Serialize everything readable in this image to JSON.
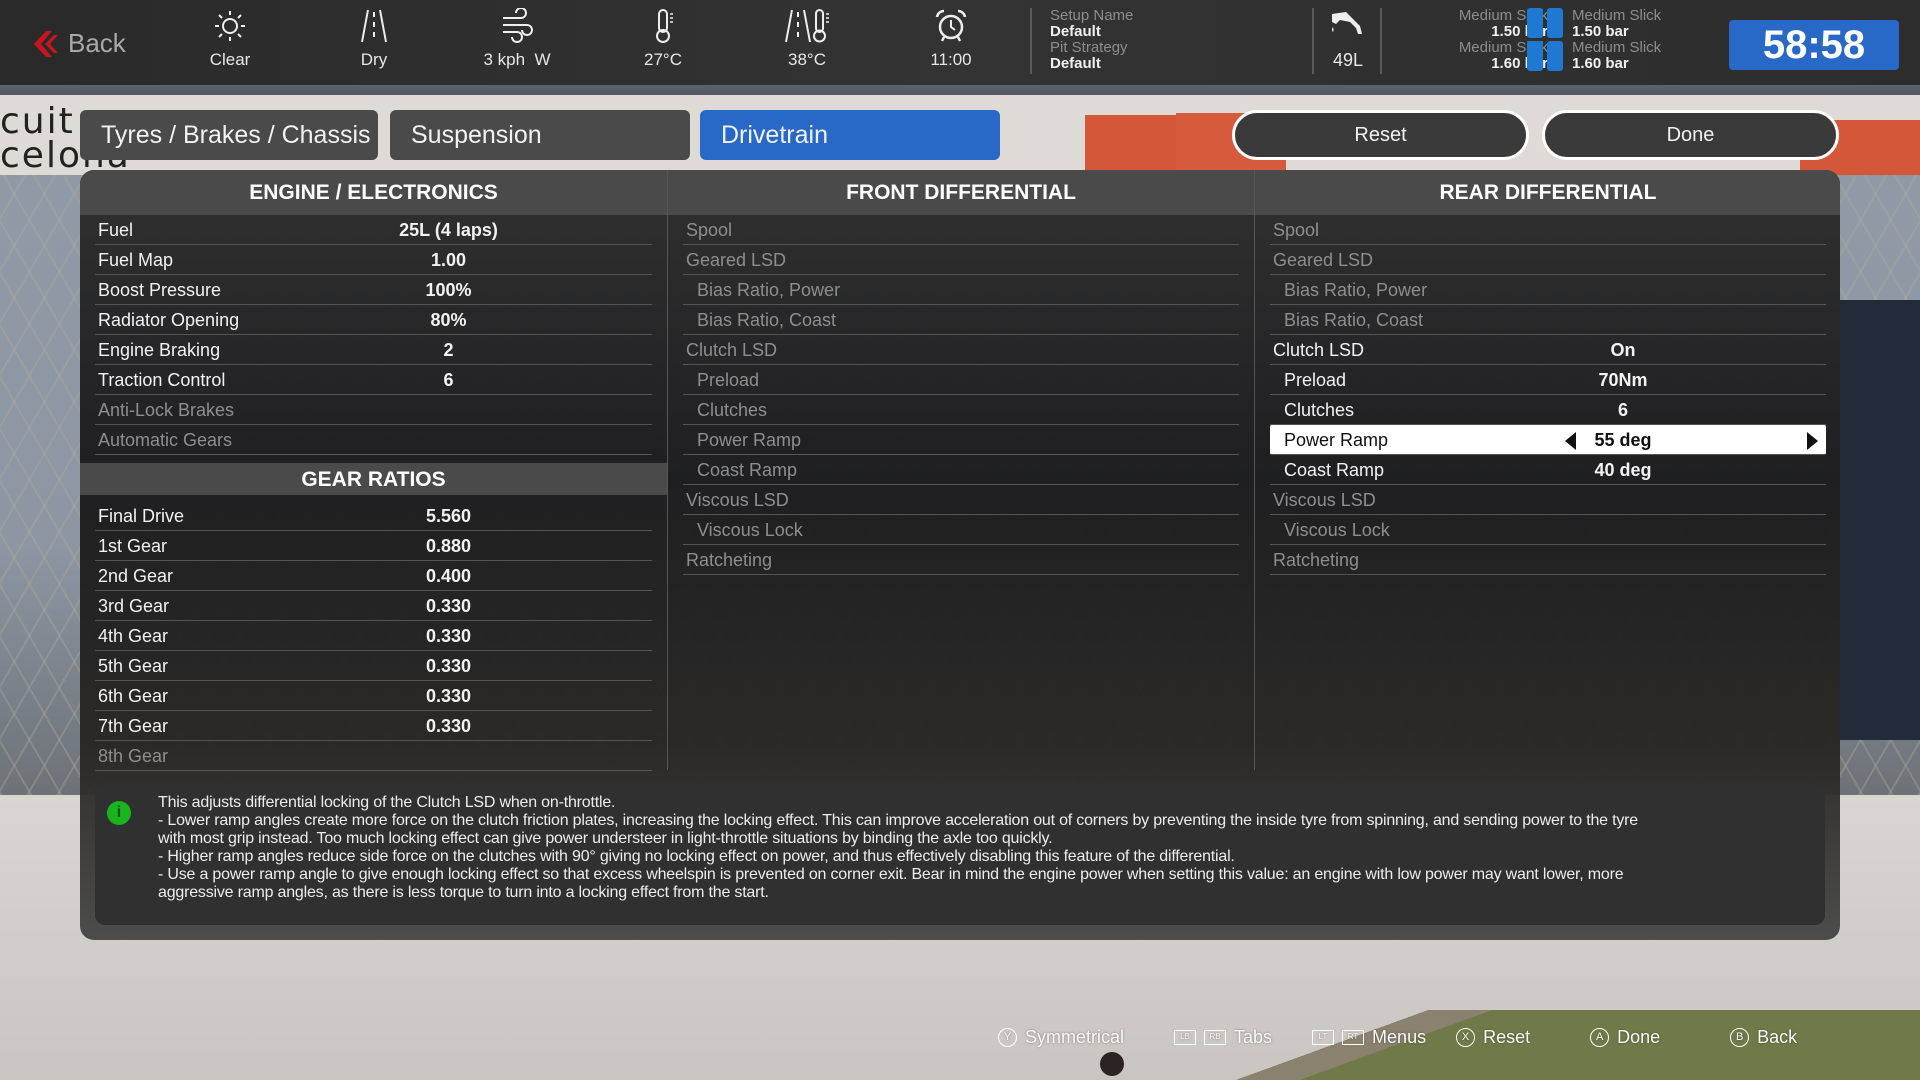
{
  "topbar": {
    "back_label": "Back",
    "weather": {
      "icon": "sun-icon",
      "label": "Clear"
    },
    "track_condition": {
      "icon": "road-icon",
      "label": "Dry"
    },
    "wind": {
      "icon": "wind-icon",
      "label": "3 kph  W"
    },
    "air_temp": {
      "icon": "thermometer-icon",
      "label": "27°C"
    },
    "track_temp": {
      "icon": "road-thermometer-icon",
      "label": "38°C"
    },
    "time_of_day": {
      "icon": "alarm-clock-icon",
      "label": "11:00"
    },
    "setup_name_key": "Setup Name",
    "setup_name_value": "Default",
    "pit_strategy_key": "Pit Strategy",
    "pit_strategy_value": "Default",
    "fuel": {
      "icon": "fuel-nozzle-icon",
      "label": "49L"
    },
    "tyres": {
      "front_left": {
        "compound": "Medium Slick",
        "pressure": "1.50 bar"
      },
      "front_right": {
        "compound": "Medium Slick",
        "pressure": "1.50 bar"
      },
      "rear_left": {
        "compound": "Medium Slick",
        "pressure": "1.60 bar"
      },
      "rear_right": {
        "compound": "Medium Slick",
        "pressure": "1.60 bar"
      },
      "color": "#1f78d1"
    },
    "timer": "58:58"
  },
  "tabs": [
    {
      "label": "Tyres / Brakes / Chassis",
      "active": false
    },
    {
      "label": "Suspension",
      "active": false
    },
    {
      "label": "Drivetrain",
      "active": true
    }
  ],
  "actions": {
    "reset_label": "Reset",
    "done_label": "Done"
  },
  "engine": {
    "title": "ENGINE / ELECTRONICS",
    "rows": [
      {
        "label": "Fuel",
        "value": "25L  (4 laps)"
      },
      {
        "label": "Fuel Map",
        "value": "1.00"
      },
      {
        "label": "Boost Pressure",
        "value": "100%"
      },
      {
        "label": "Radiator Opening",
        "value": "80%"
      },
      {
        "label": "Engine Braking",
        "value": "2"
      },
      {
        "label": "Traction Control",
        "value": "6"
      },
      {
        "label": "Anti-Lock Brakes",
        "value": ""
      },
      {
        "label": "Automatic Gears",
        "value": ""
      }
    ]
  },
  "gear_ratios": {
    "title": "GEAR RATIOS",
    "rows": [
      {
        "label": "Final Drive",
        "value": "5.560"
      },
      {
        "label": "1st Gear",
        "value": "0.880"
      },
      {
        "label": "2nd Gear",
        "value": "0.400"
      },
      {
        "label": "3rd Gear",
        "value": "0.330"
      },
      {
        "label": "4th Gear",
        "value": "0.330"
      },
      {
        "label": "5th Gear",
        "value": "0.330"
      },
      {
        "label": "6th Gear",
        "value": "0.330"
      },
      {
        "label": "7th Gear",
        "value": "0.330"
      },
      {
        "label": "8th Gear",
        "value": ""
      }
    ]
  },
  "front_diff": {
    "title": "FRONT DIFFERENTIAL",
    "rows": [
      {
        "label": "Spool",
        "value": ""
      },
      {
        "label": "Geared LSD",
        "value": ""
      },
      {
        "label": "Bias Ratio, Power",
        "value": ""
      },
      {
        "label": "Bias Ratio, Coast",
        "value": ""
      },
      {
        "label": "Clutch LSD",
        "value": ""
      },
      {
        "label": "Preload",
        "value": ""
      },
      {
        "label": "Clutches",
        "value": ""
      },
      {
        "label": "Power Ramp",
        "value": ""
      },
      {
        "label": "Coast Ramp",
        "value": ""
      },
      {
        "label": "Viscous LSD",
        "value": ""
      },
      {
        "label": "Viscous Lock",
        "value": ""
      },
      {
        "label": "Ratcheting",
        "value": ""
      }
    ]
  },
  "rear_diff": {
    "title": "REAR DIFFERENTIAL",
    "rows": [
      {
        "label": "Spool",
        "value": ""
      },
      {
        "label": "Geared LSD",
        "value": ""
      },
      {
        "label": "Bias Ratio, Power",
        "value": ""
      },
      {
        "label": "Bias Ratio, Coast",
        "value": ""
      },
      {
        "label": "Clutch LSD",
        "value": "On"
      },
      {
        "label": "Preload",
        "value": "70Nm"
      },
      {
        "label": "Clutches",
        "value": "6"
      },
      {
        "label": "Power Ramp",
        "value": "55 deg"
      },
      {
        "label": "Coast Ramp",
        "value": "40 deg"
      },
      {
        "label": "Viscous LSD",
        "value": ""
      },
      {
        "label": "Viscous Lock",
        "value": ""
      },
      {
        "label": "Ratcheting",
        "value": ""
      }
    ]
  },
  "info": {
    "icon": "info-icon",
    "lines": [
      "This adjusts differential locking of the Clutch LSD when on-throttle.",
      "- Lower ramp angles create more force on the clutch friction plates, increasing the locking effect.  This can improve acceleration out of corners by preventing the inside tyre from spinning, and sending power to the tyre",
      "with most grip instead. Too much locking effect can give power understeer in light-throttle situations by binding the axle too quickly.",
      "- Higher ramp angles reduce side force on the clutches with 90° giving no locking effect on power, and thus effectively disabling this feature of the differential.",
      "- Use a power ramp angle to give enough locking effect so that excess wheelspin is prevented on corner exit. Bear in mind the engine power when setting this value: an engine with low power may want lower, more",
      "aggressive ramp angles, as there is less torque to turn into a locking effect from the start."
    ]
  },
  "hints": [
    {
      "buttons": [
        "Y"
      ],
      "label": "Symmetrical"
    },
    {
      "buttons": [
        "LB",
        "RB"
      ],
      "label": "Tabs"
    },
    {
      "buttons": [
        "LT",
        "RT"
      ],
      "label": "Menus"
    },
    {
      "buttons": [
        "X"
      ],
      "label": "Reset"
    },
    {
      "buttons": [
        "A"
      ],
      "label": "Done"
    },
    {
      "buttons": [
        "B"
      ],
      "label": "Back"
    }
  ]
}
